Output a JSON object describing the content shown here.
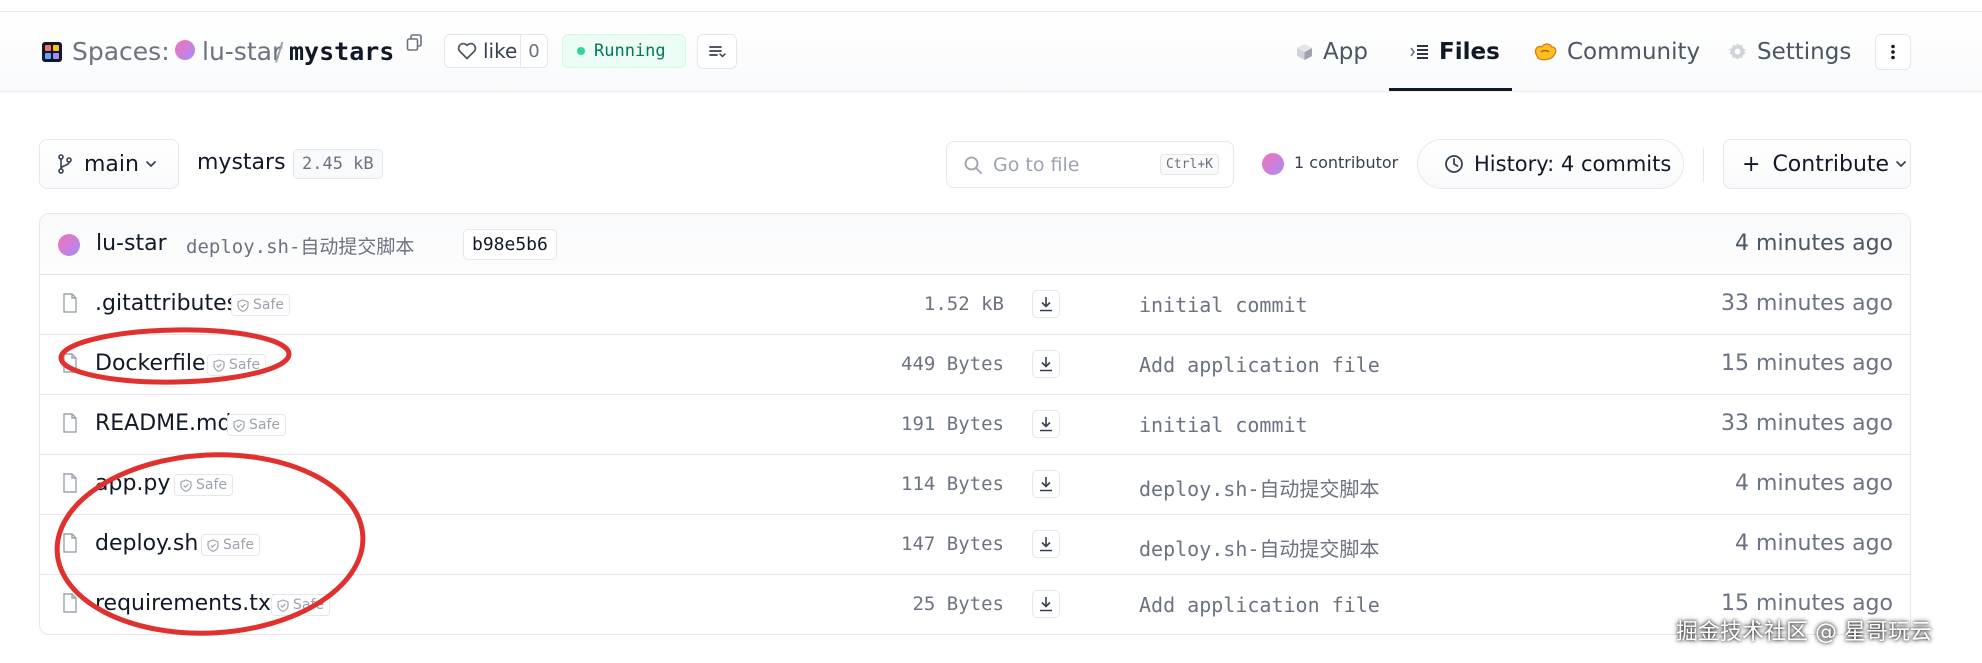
{
  "header": {
    "spaces_label": "Spaces:",
    "owner": "lu-star",
    "separator": "/",
    "repo": "mystars",
    "like_label": "like",
    "like_count": "0",
    "status": "Running",
    "tabs": [
      {
        "label": "App",
        "icon": "cube-icon",
        "active": false
      },
      {
        "label": "Files",
        "icon": "files-icon",
        "active": true
      },
      {
        "label": "Community",
        "icon": "community-icon",
        "active": false
      },
      {
        "label": "Settings",
        "icon": "gear-icon",
        "active": false
      }
    ]
  },
  "toolbar": {
    "branch": "main",
    "path": "mystars",
    "size": "2.45 kB",
    "goto_placeholder": "Go to file",
    "goto_shortcut": "Ctrl+K",
    "contributors": "1 contributor",
    "history": "History: 4 commits",
    "contribute": "Contribute"
  },
  "last_commit": {
    "author": "lu-star",
    "message": "deploy.sh-自动提交脚本",
    "hash": "b98e5b6",
    "time": "4 minutes ago"
  },
  "safe_label": "Safe",
  "files": [
    {
      "name": ".gitattributes",
      "size": "1.52 kB",
      "commit": "initial commit",
      "time": "33 minutes ago"
    },
    {
      "name": "Dockerfile",
      "size": "449 Bytes",
      "commit": "Add application file",
      "time": "15 minutes ago"
    },
    {
      "name": "README.md",
      "size": "191 Bytes",
      "commit": "initial commit",
      "time": "33 minutes ago"
    },
    {
      "name": "app.py",
      "size": "114 Bytes",
      "commit": "deploy.sh-自动提交脚本",
      "time": "4 minutes ago"
    },
    {
      "name": "deploy.sh",
      "size": "147 Bytes",
      "commit": "deploy.sh-自动提交脚本",
      "time": "4 minutes ago"
    },
    {
      "name": "requirements.txt",
      "size": "25 Bytes",
      "commit": "Add application file",
      "time": "15 minutes ago"
    }
  ],
  "watermark": "掘金技术社区 @ 星哥玩云",
  "colors": {
    "running_green": "#047857",
    "annotation_red": "#e0312e",
    "avatar_gradient_start": "#f472b6",
    "avatar_gradient_end": "#a78bfa"
  }
}
